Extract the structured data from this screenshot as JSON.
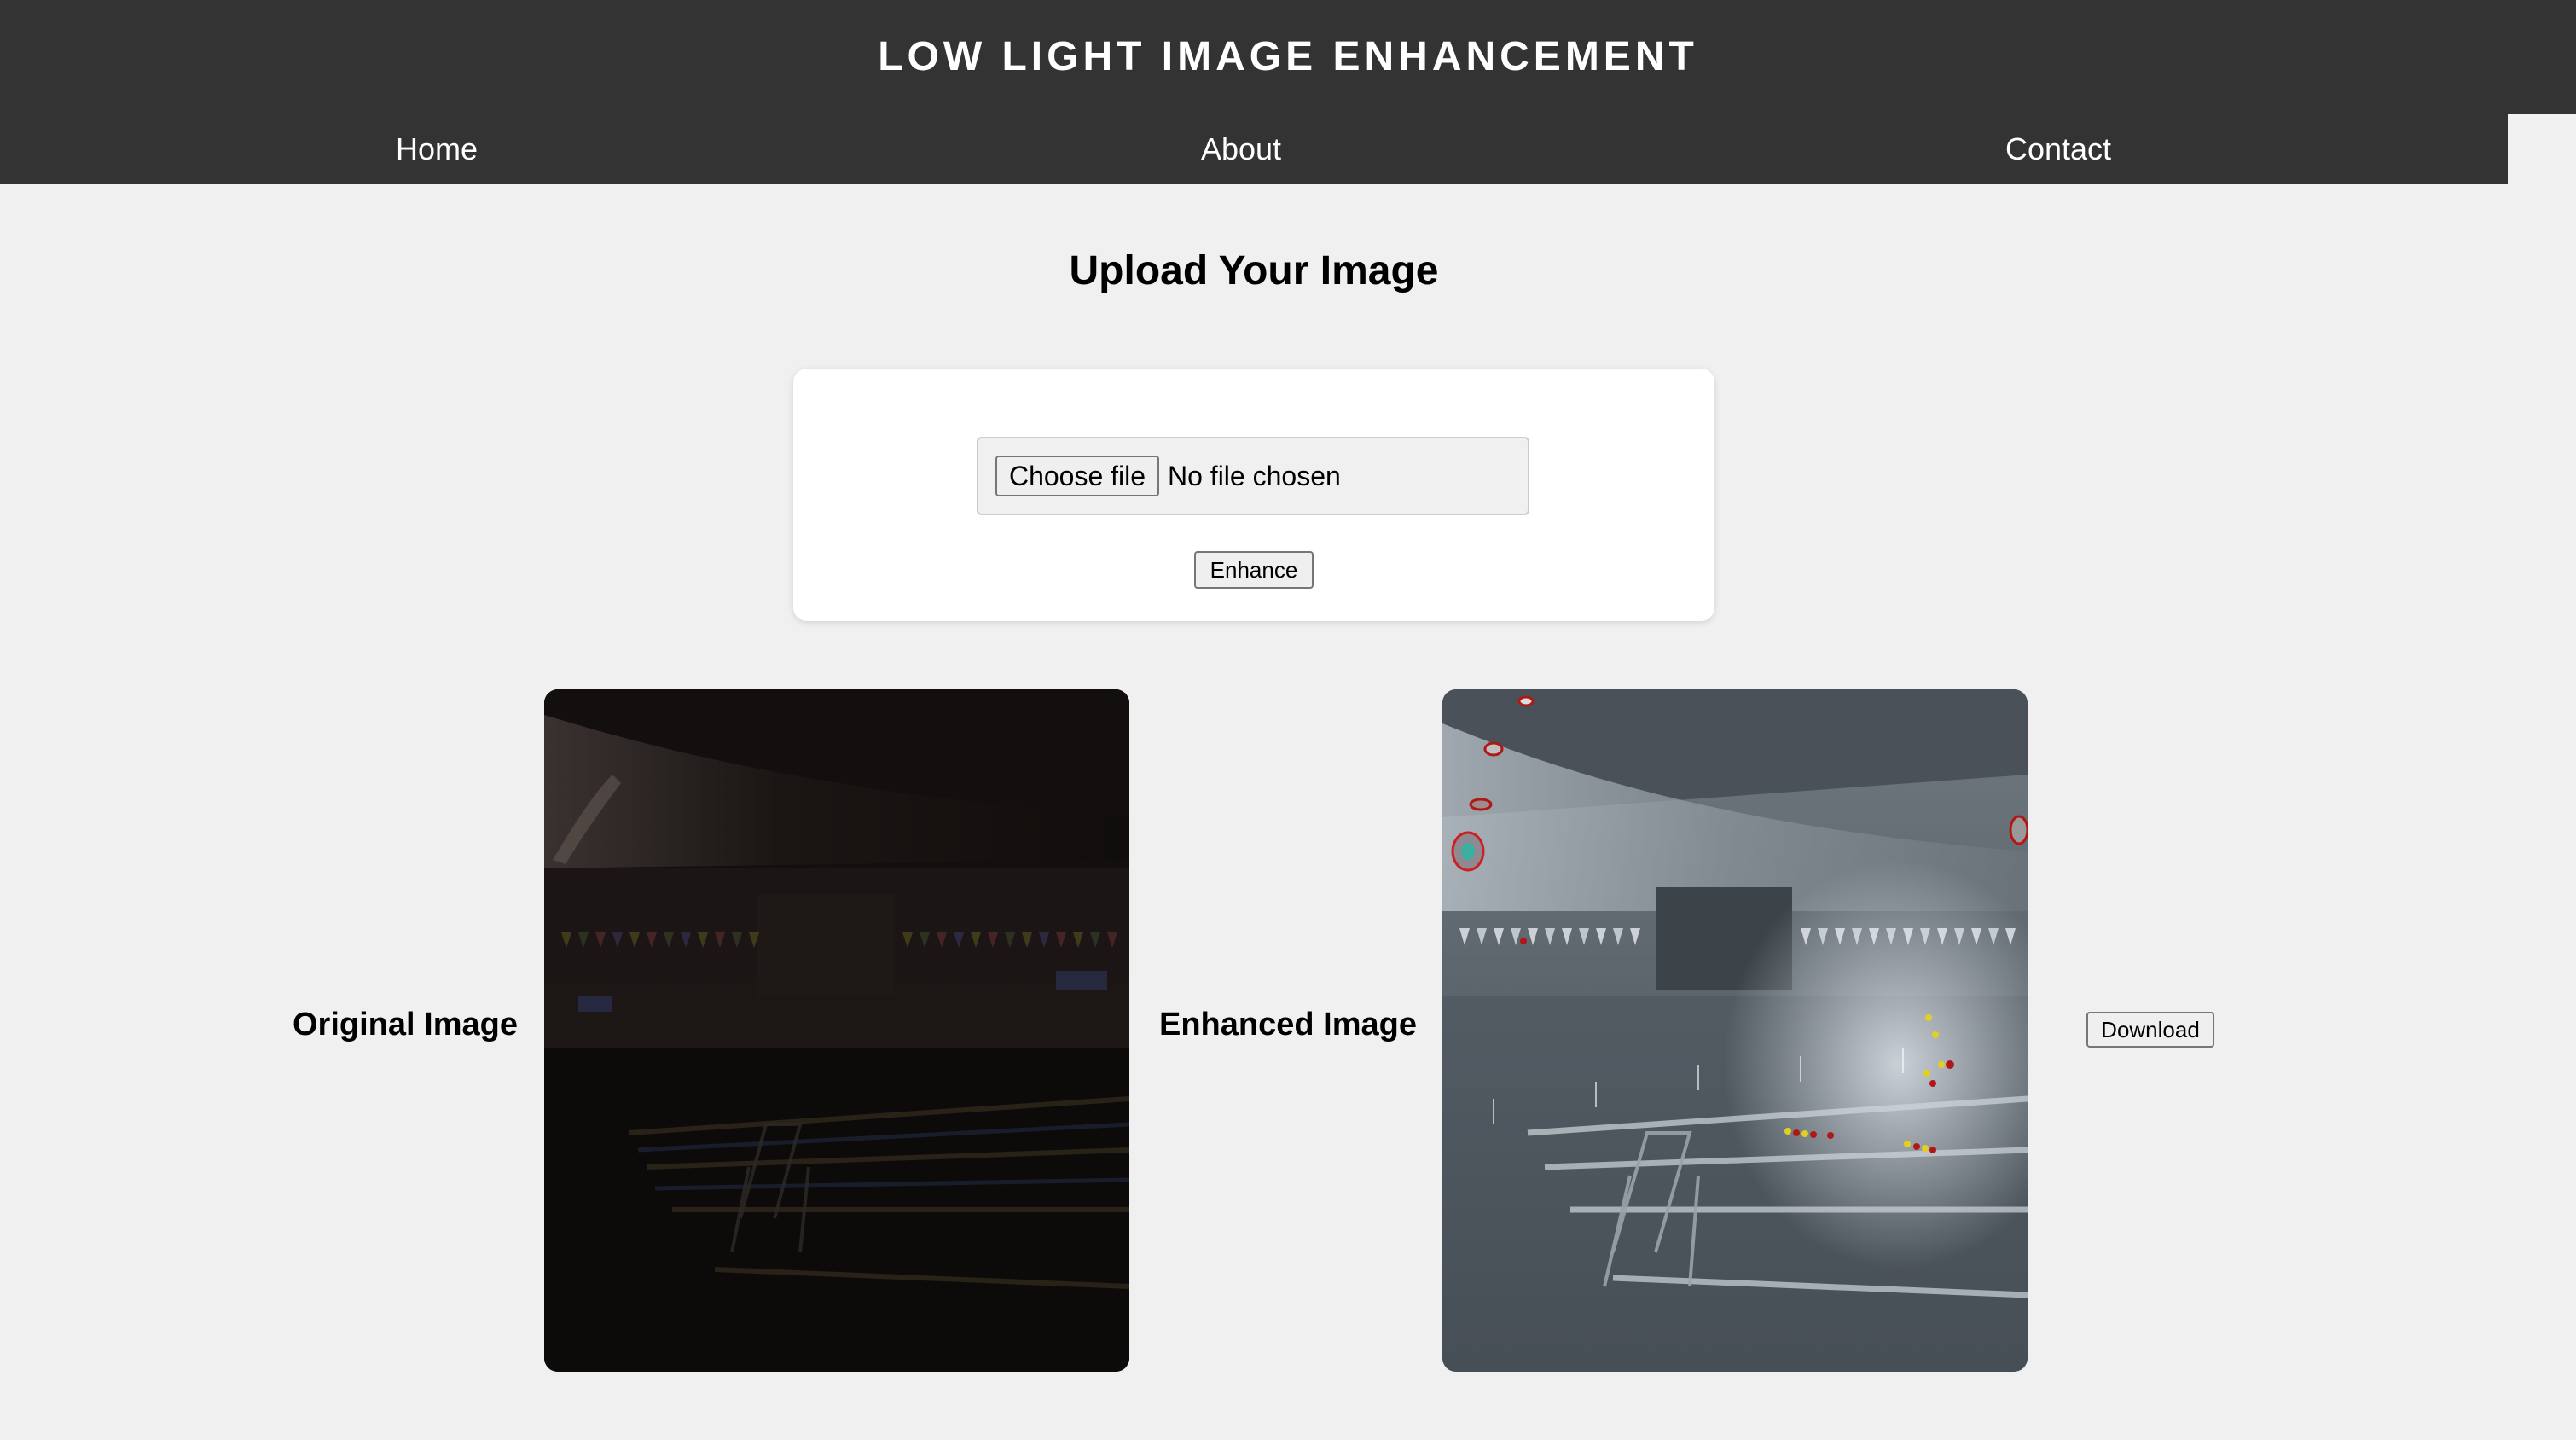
{
  "header": {
    "title": "LOW LIGHT IMAGE ENHANCEMENT"
  },
  "nav": {
    "items": [
      {
        "label": "Home"
      },
      {
        "label": "About"
      },
      {
        "label": "Contact"
      }
    ]
  },
  "upload": {
    "title": "Upload Your Image",
    "choose_file_label": "Choose file",
    "file_status": "No file chosen",
    "enhance_label": "Enhance"
  },
  "results": {
    "original_label": "Original Image",
    "enhanced_label": "Enhanced Image",
    "download_label": "Download"
  },
  "colors": {
    "header_bg": "#333333",
    "page_bg": "#f0f0f0",
    "card_bg": "#ffffff"
  }
}
